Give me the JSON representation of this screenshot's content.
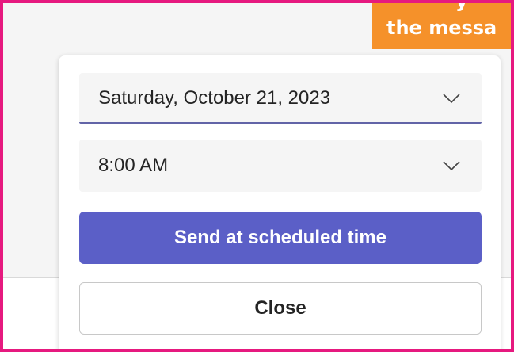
{
  "callout": {
    "line1": "y",
    "line2": "the messa",
    "color": "#f5912a"
  },
  "schedule": {
    "date_value": "Saturday, October 21, 2023",
    "time_value": "8:00 AM",
    "send_button_label": "Send at scheduled time",
    "close_button_label": "Close"
  },
  "colors": {
    "accent": "#5b5fc7",
    "frame": "#e6197f",
    "field_bg": "#f5f5f5"
  },
  "icons": {
    "date_dropdown": "chevron-down-icon",
    "time_dropdown": "chevron-down-icon"
  }
}
